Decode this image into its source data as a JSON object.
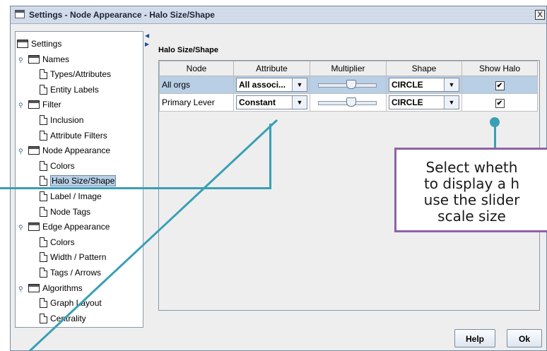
{
  "window": {
    "title": "Settings - Node Appearance - Halo Size/Shape",
    "close_glyph": "X"
  },
  "tree": {
    "root": "Settings",
    "groups": [
      {
        "label": "Names",
        "children": [
          "Types/Attributes",
          "Entity Labels"
        ]
      },
      {
        "label": "Filter",
        "children": [
          "Inclusion",
          "Attribute Filters"
        ]
      },
      {
        "label": "Node Appearance",
        "children": [
          "Colors",
          "Halo Size/Shape",
          "Label / Image",
          "Node Tags"
        ]
      },
      {
        "label": "Edge Appearance",
        "children": [
          "Colors",
          "Width / Pattern",
          "Tags / Arrows"
        ]
      },
      {
        "label": "Algorithms",
        "children": [
          "Graph Layout",
          "Centrality"
        ]
      }
    ],
    "selected": "Halo Size/Shape"
  },
  "panel": {
    "title": "Halo Size/Shape",
    "columns": [
      "Node",
      "Attribute",
      "Multiplier",
      "Shape",
      "Show Halo"
    ],
    "rows": [
      {
        "node": "All orgs",
        "attribute": "All associ...",
        "multiplier": 0.55,
        "shape": "CIRCLE",
        "show_halo": true,
        "selected": true
      },
      {
        "node": "Primary Lever",
        "attribute": "Constant",
        "multiplier": 0.55,
        "shape": "CIRCLE",
        "show_halo": true,
        "selected": false
      }
    ]
  },
  "buttons": {
    "help": "Help",
    "ok": "Ok"
  },
  "callout": {
    "text": "Select wheth\nto display a h\nuse the slider\nscale size"
  },
  "colors": {
    "accent_line": "#3a9fb5",
    "callout_border": "#8d62a8",
    "selection": "#b8cfe5"
  },
  "icons": {
    "checkbox": "✔",
    "dropdown": "▼"
  }
}
